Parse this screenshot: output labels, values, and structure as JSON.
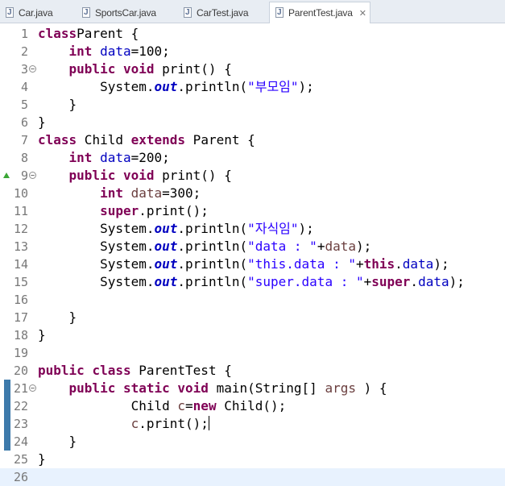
{
  "tabs": [
    {
      "label": "Car.java",
      "active": false
    },
    {
      "label": "SportsCar.java",
      "active": false
    },
    {
      "label": "CarTest.java",
      "active": false
    },
    {
      "label": "ParentTest.java",
      "active": true
    }
  ],
  "editor": {
    "current_line": 26,
    "lines": [
      {
        "n": "1",
        "tokens": [
          [
            "kw",
            "class"
          ],
          [
            "",
            "Parent {"
          ]
        ]
      },
      {
        "n": "2",
        "tokens": [
          [
            "",
            "    "
          ],
          [
            "kw",
            "int"
          ],
          [
            "",
            " "
          ],
          [
            "fld",
            "data"
          ],
          [
            "",
            "=100;"
          ]
        ]
      },
      {
        "n": "3",
        "fold": true,
        "tokens": [
          [
            "",
            "    "
          ],
          [
            "kw",
            "public"
          ],
          [
            "",
            " "
          ],
          [
            "kw",
            "void"
          ],
          [
            "",
            " print() {"
          ]
        ]
      },
      {
        "n": "4",
        "tokens": [
          [
            "",
            "        System."
          ],
          [
            "stat",
            "out"
          ],
          [
            "",
            ".println("
          ],
          [
            "str",
            "\"부모임\""
          ],
          [
            "",
            ");"
          ]
        ]
      },
      {
        "n": "5",
        "tokens": [
          [
            "",
            "    }"
          ]
        ]
      },
      {
        "n": "6",
        "tokens": [
          [
            "",
            "}"
          ]
        ]
      },
      {
        "n": "7",
        "tokens": [
          [
            "kw",
            "class"
          ],
          [
            "",
            " Child "
          ],
          [
            "kw",
            "extends"
          ],
          [
            "",
            " Parent {"
          ]
        ]
      },
      {
        "n": "8",
        "tokens": [
          [
            "",
            "    "
          ],
          [
            "kw",
            "int"
          ],
          [
            "",
            " "
          ],
          [
            "fld",
            "data"
          ],
          [
            "",
            "=200;"
          ]
        ]
      },
      {
        "n": "9",
        "fold": true,
        "override": true,
        "tokens": [
          [
            "",
            "    "
          ],
          [
            "kw",
            "public"
          ],
          [
            "",
            " "
          ],
          [
            "kw",
            "void"
          ],
          [
            "",
            " print() {"
          ]
        ]
      },
      {
        "n": "10",
        "tokens": [
          [
            "",
            "        "
          ],
          [
            "kw",
            "int"
          ],
          [
            "",
            " "
          ],
          [
            "lv",
            "data"
          ],
          [
            "",
            "=300;"
          ]
        ]
      },
      {
        "n": "11",
        "tokens": [
          [
            "",
            "        "
          ],
          [
            "kw",
            "super"
          ],
          [
            "",
            ".print();"
          ]
        ]
      },
      {
        "n": "12",
        "tokens": [
          [
            "",
            "        System."
          ],
          [
            "stat",
            "out"
          ],
          [
            "",
            ".println("
          ],
          [
            "str",
            "\"자식임\""
          ],
          [
            "",
            ");"
          ]
        ]
      },
      {
        "n": "13",
        "tokens": [
          [
            "",
            "        System."
          ],
          [
            "stat",
            "out"
          ],
          [
            "",
            ".println("
          ],
          [
            "str",
            "\"data : \""
          ],
          [
            "",
            "+"
          ],
          [
            "lv",
            "data"
          ],
          [
            "",
            ");"
          ]
        ]
      },
      {
        "n": "14",
        "tokens": [
          [
            "",
            "        System."
          ],
          [
            "stat",
            "out"
          ],
          [
            "",
            ".println("
          ],
          [
            "str",
            "\"this.data : \""
          ],
          [
            "",
            "+"
          ],
          [
            "kw",
            "this"
          ],
          [
            "",
            "."
          ],
          [
            "fld",
            "data"
          ],
          [
            "",
            ");"
          ]
        ]
      },
      {
        "n": "15",
        "tokens": [
          [
            "",
            "        System."
          ],
          [
            "stat",
            "out"
          ],
          [
            "",
            ".println("
          ],
          [
            "str",
            "\"super.data : \""
          ],
          [
            "",
            "+"
          ],
          [
            "kw",
            "super"
          ],
          [
            "",
            "."
          ],
          [
            "fld",
            "data"
          ],
          [
            "",
            ");"
          ]
        ]
      },
      {
        "n": "16",
        "tokens": []
      },
      {
        "n": "17",
        "tokens": [
          [
            "",
            "    }"
          ]
        ]
      },
      {
        "n": "18",
        "tokens": [
          [
            "",
            "}"
          ]
        ]
      },
      {
        "n": "19",
        "tokens": []
      },
      {
        "n": "20",
        "tokens": [
          [
            "kw",
            "public"
          ],
          [
            "",
            " "
          ],
          [
            "kw",
            "class"
          ],
          [
            "",
            " ParentTest {"
          ]
        ]
      },
      {
        "n": "21",
        "fold": true,
        "changed": true,
        "tokens": [
          [
            "",
            "    "
          ],
          [
            "kw",
            "public"
          ],
          [
            "",
            " "
          ],
          [
            "kw",
            "static"
          ],
          [
            "",
            " "
          ],
          [
            "kw",
            "void"
          ],
          [
            "",
            " main(String[] "
          ],
          [
            "lv",
            "args"
          ],
          [
            "",
            " ) {"
          ]
        ]
      },
      {
        "n": "22",
        "changed": true,
        "tokens": [
          [
            "",
            "            Child "
          ],
          [
            "lv",
            "c"
          ],
          [
            "",
            "="
          ],
          [
            "kw",
            "new"
          ],
          [
            "",
            " Child();"
          ]
        ]
      },
      {
        "n": "23",
        "changed": true,
        "caret": true,
        "tokens": [
          [
            "",
            "            "
          ],
          [
            "lv",
            "c"
          ],
          [
            "",
            ".print();"
          ]
        ]
      },
      {
        "n": "24",
        "changed": true,
        "tokens": [
          [
            "",
            "    }"
          ]
        ]
      },
      {
        "n": "25",
        "tokens": [
          [
            "",
            "}"
          ]
        ]
      },
      {
        "n": "26",
        "tokens": []
      }
    ]
  }
}
